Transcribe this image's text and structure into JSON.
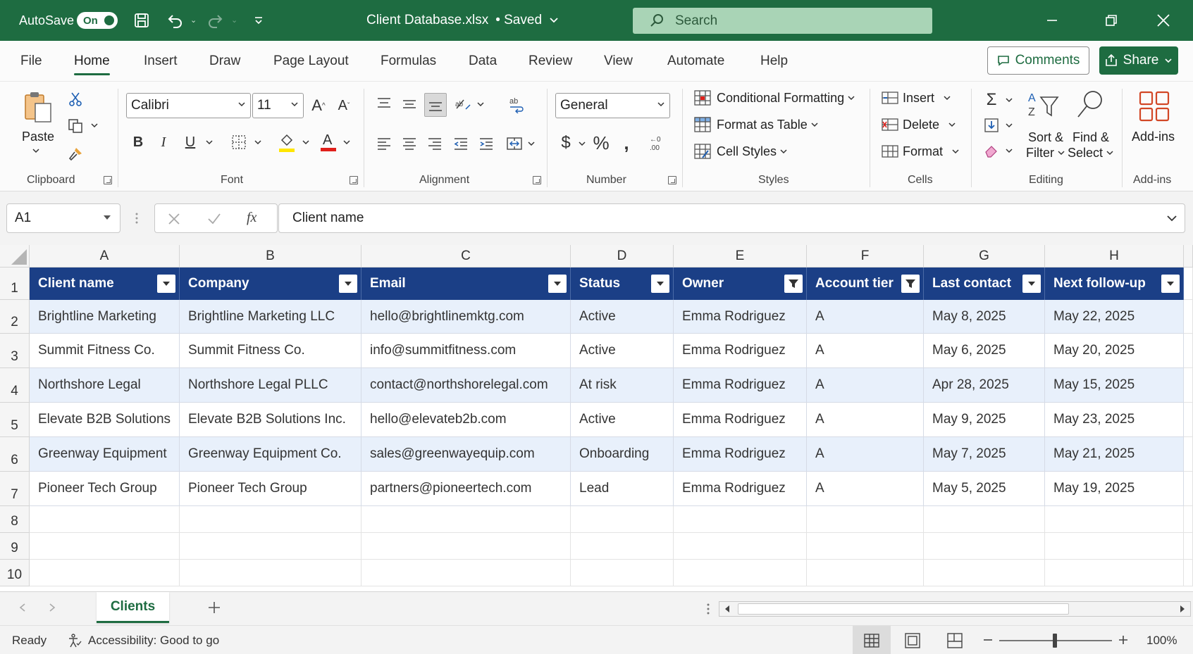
{
  "window": {
    "autosave_label": "AutoSave",
    "autosave_state": "On",
    "doc_title": "Client Database.xlsx",
    "doc_status": "• Saved",
    "search_placeholder": "Search"
  },
  "tabs": [
    "File",
    "Home",
    "Insert",
    "Draw",
    "Page Layout",
    "Formulas",
    "Data",
    "Review",
    "View",
    "Automate",
    "Help"
  ],
  "active_tab": "Home",
  "top_buttons": {
    "comments": "Comments",
    "share": "Share"
  },
  "ribbon": {
    "clipboard": {
      "paste": "Paste",
      "label": "Clipboard"
    },
    "font": {
      "name": "Calibri",
      "size": "11",
      "label": "Font",
      "fill_color": "#ffe600",
      "font_color": "#e0201b"
    },
    "alignment": {
      "label": "Alignment"
    },
    "number": {
      "format": "General",
      "label": "Number"
    },
    "styles": {
      "conditional": "Conditional Formatting",
      "table": "Format as Table",
      "cell": "Cell Styles",
      "label": "Styles"
    },
    "cells": {
      "insert": "Insert",
      "delete": "Delete",
      "format": "Format",
      "label": "Cells"
    },
    "editing": {
      "sort1": "Sort &",
      "sort2": "Filter",
      "find1": "Find &",
      "find2": "Select",
      "label": "Editing"
    },
    "addins": {
      "button": "Add-ins",
      "label": "Add-ins"
    }
  },
  "formula_bar": {
    "name_box": "A1",
    "fx": "fx",
    "content": "Client name"
  },
  "sheet": {
    "columns": [
      "A",
      "B",
      "C",
      "D",
      "E",
      "F",
      "G",
      "H"
    ],
    "rows": [
      "1",
      "2",
      "3",
      "4",
      "5",
      "6",
      "7",
      "8",
      "9",
      "10"
    ],
    "headers": [
      "Client name",
      "Company",
      "Email",
      "Status",
      "Owner",
      "Account tier",
      "Last contact",
      "Next follow-up"
    ],
    "filtered_columns": [
      "Owner",
      "Account tier"
    ],
    "data": [
      [
        "Brightline Marketing",
        "Brightline Marketing LLC",
        "hello@brightlinemktg.com",
        "Active",
        "Emma Rodriguez",
        "A",
        "May 8, 2025",
        "May 22, 2025"
      ],
      [
        "Summit Fitness Co.",
        "Summit Fitness Co.",
        "info@summitfitness.com",
        "Active",
        "Emma Rodriguez",
        "A",
        "May 6, 2025",
        "May 20, 2025"
      ],
      [
        "Northshore Legal",
        "Northshore Legal PLLC",
        "contact@northshorelegal.com",
        "At risk",
        "Emma Rodriguez",
        "A",
        "Apr 28, 2025",
        "May 15, 2025"
      ],
      [
        "Elevate B2B Solutions",
        "Elevate B2B Solutions Inc.",
        "hello@elevateb2b.com",
        "Active",
        "Emma Rodriguez",
        "A",
        "May 9, 2025",
        "May 23, 2025"
      ],
      [
        "Greenway Equipment",
        "Greenway Equipment Co.",
        "sales@greenwayequip.com",
        "Onboarding",
        "Emma Rodriguez",
        "A",
        "May 7, 2025",
        "May 21, 2025"
      ],
      [
        "Pioneer Tech Group",
        "Pioneer Tech Group",
        "partners@pioneertech.com",
        "Lead",
        "Emma Rodriguez",
        "A",
        "May 5, 2025",
        "May 19, 2025"
      ]
    ],
    "sheet_tab": "Clients"
  },
  "status": {
    "ready": "Ready",
    "accessibility": "Accessibility: Good to go",
    "zoom": "100%"
  }
}
